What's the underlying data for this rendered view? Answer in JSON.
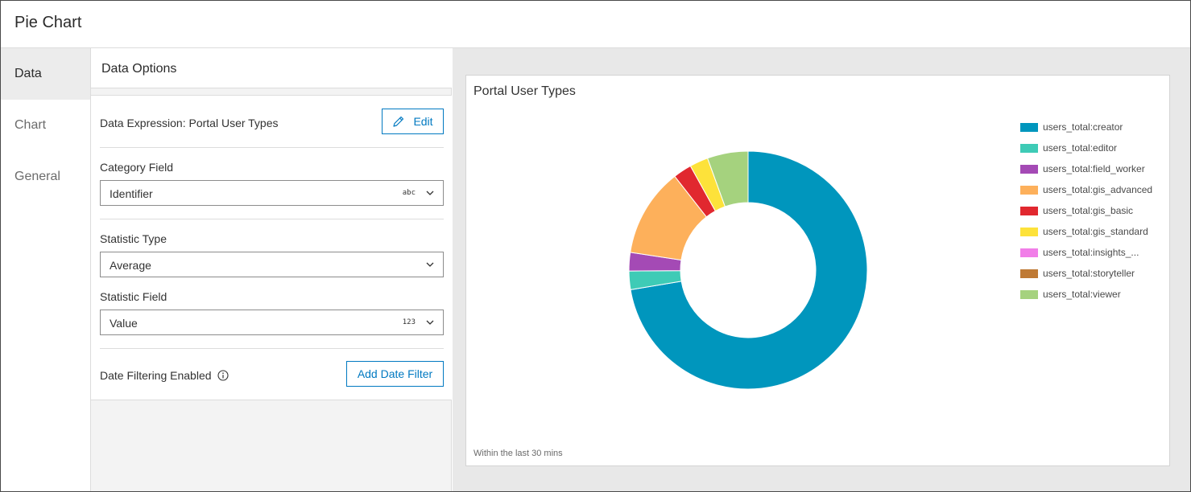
{
  "app": {
    "title": "Pie Chart"
  },
  "nav": {
    "items": [
      {
        "label": "Data",
        "active": true
      },
      {
        "label": "Chart",
        "active": false
      },
      {
        "label": "General",
        "active": false
      }
    ]
  },
  "panel": {
    "title": "Data Options",
    "data_expression": {
      "label": "Data Expression: Portal User Types",
      "button": "Edit",
      "icon": "pencil-icon"
    },
    "category_field": {
      "label": "Category Field",
      "value": "Identifier",
      "type_badge": "abc"
    },
    "statistic_type": {
      "label": "Statistic Type",
      "value": "Average"
    },
    "statistic_field": {
      "label": "Statistic Field",
      "value": "Value",
      "type_badge": "123"
    },
    "date_filter": {
      "label": "Date Filtering Enabled",
      "button": "Add Date Filter",
      "icon": "info-icon"
    }
  },
  "colors": {
    "accent": "#0079c1",
    "nav_active_bg": "#ececec",
    "canvas_bg": "#e8e8e8"
  },
  "chart_data": {
    "type": "pie",
    "style": "donut",
    "title": "Portal User Types",
    "footnote": "Within the last 30 mins",
    "legend_position": "right",
    "categories": [
      "users_total:creator",
      "users_total:editor",
      "users_total:field_worker",
      "users_total:gis_advanced",
      "users_total:gis_basic",
      "users_total:gis_standard",
      "users_total:insights_...",
      "users_total:storyteller",
      "users_total:viewer"
    ],
    "values": [
      72,
      2.5,
      2.5,
      12,
      2.5,
      2.5,
      0,
      0,
      5.5
    ],
    "colors": [
      "#0096bd",
      "#3ecbb6",
      "#a44ab5",
      "#fdb05b",
      "#e1282f",
      "#fde23a",
      "#f17ee8",
      "#bf7a35",
      "#a5d27e"
    ]
  }
}
